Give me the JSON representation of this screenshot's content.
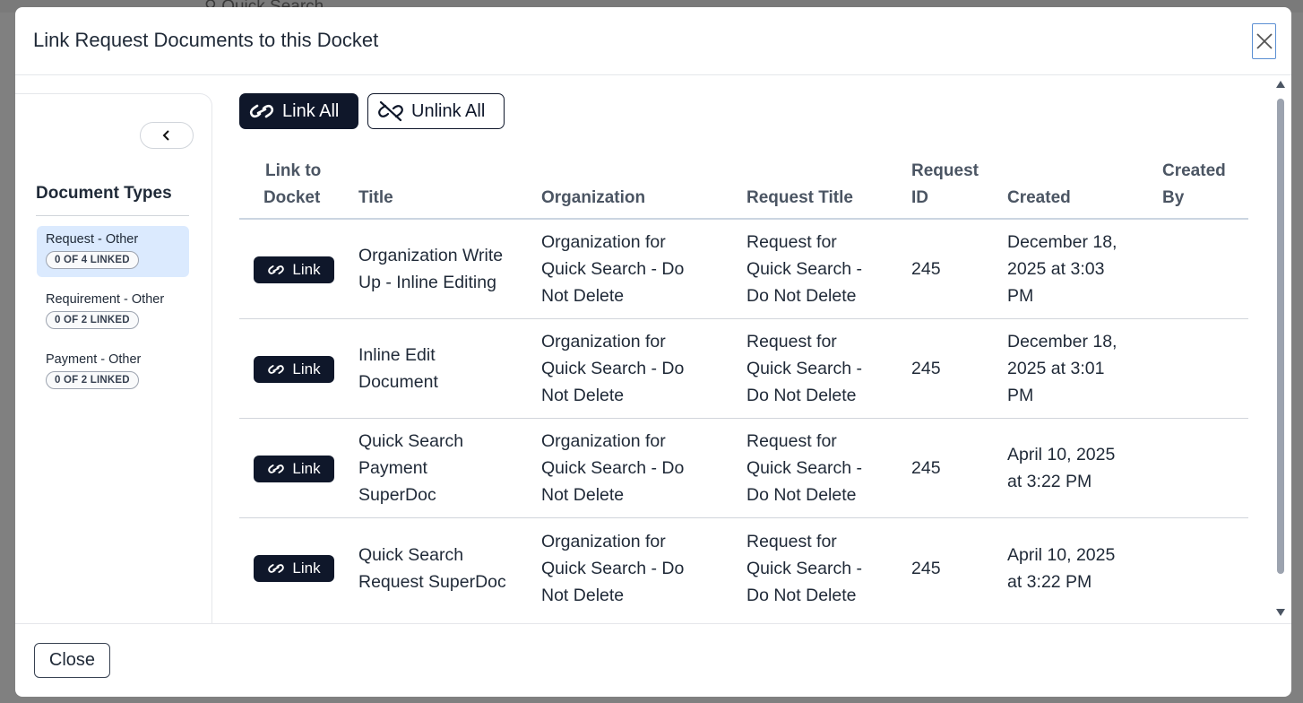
{
  "background": {
    "search_placeholder": "Quick Search"
  },
  "modal": {
    "title": "Link Request Documents to this Docket",
    "close_label": "Close"
  },
  "sidebar": {
    "heading": "Document Types",
    "types": [
      {
        "label": "Request - Other",
        "badge": "0 OF 4 LINKED",
        "active": true
      },
      {
        "label": "Requirement - Other",
        "badge": "0 OF 2 LINKED",
        "active": false
      },
      {
        "label": "Payment - Other",
        "badge": "0 OF 2 LINKED",
        "active": false
      }
    ]
  },
  "toolbar": {
    "link_all": "Link All",
    "unlink_all": "Unlink All"
  },
  "table": {
    "headers": {
      "link": [
        "Link to",
        "Docket"
      ],
      "title": "Title",
      "organization": "Organization",
      "request_title": "Request Title",
      "request_id": [
        "Request",
        "ID"
      ],
      "created": "Created",
      "created_by": [
        "Created",
        "By"
      ]
    },
    "link_label": "Link",
    "rows": [
      {
        "title": [
          "Organization Write",
          "Up - Inline Editing"
        ],
        "organization": [
          "Organization for",
          "Quick Search - Do",
          "Not Delete"
        ],
        "request_title": [
          "Request for",
          "Quick Search -",
          "Do Not Delete"
        ],
        "request_id": "245",
        "created": [
          "December 18,",
          "2025 at 3:03",
          "PM"
        ],
        "created_by": ""
      },
      {
        "title": [
          "Inline Edit",
          "Document"
        ],
        "organization": [
          "Organization for",
          "Quick Search - Do",
          "Not Delete"
        ],
        "request_title": [
          "Request for",
          "Quick Search -",
          "Do Not Delete"
        ],
        "request_id": "245",
        "created": [
          "December 18,",
          "2025 at 3:01",
          "PM"
        ],
        "created_by": ""
      },
      {
        "title": [
          "Quick Search",
          "Payment",
          "SuperDoc"
        ],
        "organization": [
          "Organization for",
          "Quick Search - Do",
          "Not Delete"
        ],
        "request_title": [
          "Request for",
          "Quick Search -",
          "Do Not Delete"
        ],
        "request_id": "245",
        "created": [
          "April 10, 2025",
          "at 3:22 PM"
        ],
        "created_by": ""
      },
      {
        "title": [
          "Quick Search",
          "Request SuperDoc"
        ],
        "organization": [
          "Organization for",
          "Quick Search - Do",
          "Not Delete"
        ],
        "request_title": [
          "Request for",
          "Quick Search -",
          "Do Not Delete"
        ],
        "request_id": "245",
        "created": [
          "April 10, 2025",
          "at 3:22 PM"
        ],
        "created_by": ""
      }
    ]
  },
  "colors": {
    "primary_dark": "#0f172a",
    "active_type_bg": "#dbeafe",
    "close_focus": "#5b8fd3"
  }
}
